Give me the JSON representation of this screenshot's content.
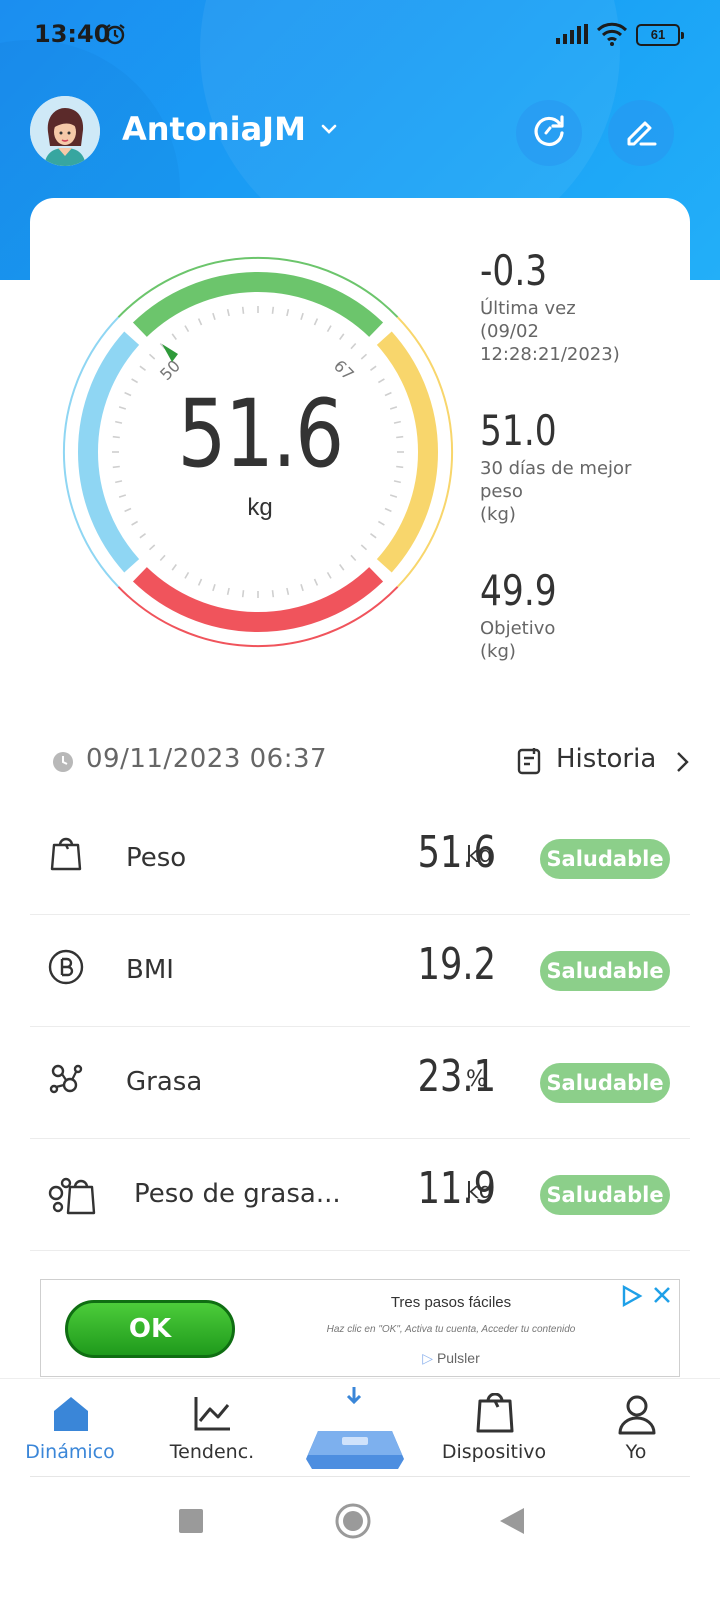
{
  "status_bar": {
    "time": "13:40",
    "battery": "61",
    "icons": [
      "alarm-icon",
      "signal-icon",
      "wifi-icon",
      "battery-icon"
    ]
  },
  "header": {
    "username": "AntoniaJM",
    "actions": [
      "sync-icon",
      "edit-icon"
    ]
  },
  "gauge": {
    "value": "51.6",
    "unit": "kg",
    "tick_low": "50",
    "tick_high": "67",
    "colors": {
      "blue": "#8fd6f3",
      "green": "#6cc56c",
      "yellow": "#f8d66c",
      "red": "#f0545c"
    }
  },
  "stats": [
    {
      "value": "-0.3",
      "label_lines": [
        "Última vez",
        "(09/02",
        "12:28:21/2023)"
      ]
    },
    {
      "value": "51.0",
      "label_lines": [
        "30 días de mejor",
        "peso",
        "(kg)"
      ]
    },
    {
      "value": "49.9",
      "label_lines": [
        "Objetivo",
        "(kg)"
      ]
    }
  ],
  "measurement": {
    "datetime": "09/11/2023 06:37",
    "history_label": "Historia"
  },
  "metrics": [
    {
      "icon": "scale-icon",
      "label": "Peso",
      "value": "51.6",
      "unit": "kg",
      "status": "Saludable"
    },
    {
      "icon": "bmi-icon",
      "label": "BMI",
      "value": "19.2",
      "unit": "",
      "status": "Saludable"
    },
    {
      "icon": "fat-icon",
      "label": "Grasa",
      "value": "23.1",
      "unit": "%",
      "status": "Saludable"
    },
    {
      "icon": "fat-weight-icon",
      "label": "Peso de grasa...",
      "value": "11.9",
      "unit": "kg",
      "status": "Saludable"
    }
  ],
  "ad": {
    "button": "OK",
    "title": "Tres pasos fáciles",
    "subtitle": "Haz clic en \"OK\", Activa tu cuenta, Acceder tu contenido",
    "brand": "Pulsler"
  },
  "tabs": [
    {
      "label": "Dinámico",
      "icon": "home-icon",
      "active": true
    },
    {
      "label": "Tendenc.",
      "icon": "trend-icon",
      "active": false
    },
    {
      "label": "Dispositivo",
      "icon": "device-icon",
      "active": false
    },
    {
      "label": "Yo",
      "icon": "profile-icon",
      "active": false
    }
  ],
  "center_tab_icon": "scale-device-icon",
  "system_nav": [
    "recents-icon",
    "home-circle-icon",
    "back-icon"
  ],
  "accent_color": "#3a86d8",
  "badge_color": "#8ccf8a"
}
